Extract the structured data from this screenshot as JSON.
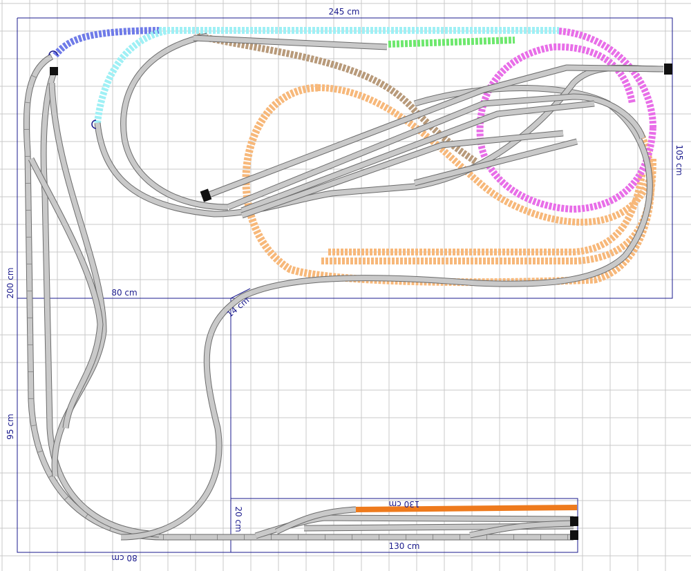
{
  "plan": {
    "dimensions": {
      "top_width": "245 cm",
      "left_height": "200 cm",
      "right_depth": "105 cm",
      "inner_width": "80 cm",
      "lower_height": "95 cm",
      "bottom_width": "80 cm",
      "shelf_length_top": "130 cm",
      "shelf_length_bottom": "130 cm",
      "shelf_depth": "20 cm",
      "diagonal": "14 cm"
    },
    "colors": {
      "outline": "#1a1a8c",
      "grid": "#c8c8c8",
      "track_gray": "#c9c9c9",
      "track_cyan": "#9ff0f5",
      "track_blue": "#6f7be8",
      "track_green": "#6ee86e",
      "track_brown": "#b89a7a",
      "track_magenta": "#e86ee8",
      "track_orange": "#f7b87a",
      "track_orange_solid": "#ee7a1c",
      "buffer_black": "#111111"
    },
    "icons": [
      "buffer-stop-icon",
      "track-end-icon"
    ]
  }
}
